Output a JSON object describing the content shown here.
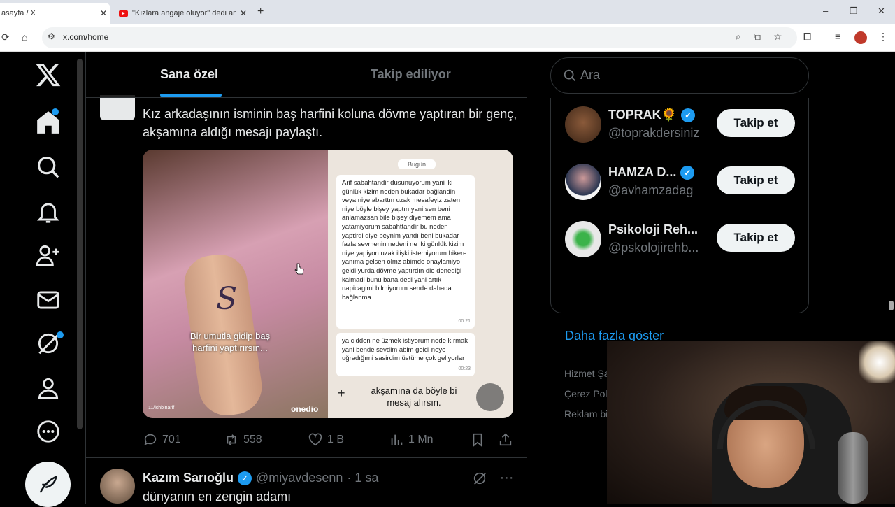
{
  "browser": {
    "active_tab_title": "asayfa / X",
    "other_tab_title": "\"Kızlara angaje oluyor\" dedi am",
    "url": "x.com/home",
    "close_glyph": "✕",
    "new_tab_glyph": "+",
    "controls": [
      "–",
      "❐",
      "✕"
    ]
  },
  "feed": {
    "tabs": [
      {
        "label": "Sana özel",
        "active": true
      },
      {
        "label": "Takip ediliyor",
        "active": false
      }
    ],
    "tweet": {
      "text": "Kız arkadaşının isminin baş harfini koluna dövme yaptıran bir genç, akşamına aldığı mesajı paylaştı.",
      "media": {
        "photo_caption": "Bir umutla gidip baş harfini yaptırırsın...",
        "tattoo_letter": "S",
        "watermark_left": "11/ichbinarif",
        "watermark_brand": "onedio",
        "chat_day": "Bugün",
        "message1": "Arif sabahtandir dusunuyorum yani iki günlük kizim neden bukadar bağlandin veya niye abarttın uzak mesafeyiz zaten niye böyle bişey yaptın yani sen beni anlamazsan bile bişey diyemem ama yatamiyorum sabahttandir bu neden yaptirdi diye beynim yandı beni bukadar fazla sevmenin nedeni ne iki günlük kizim niye yapiyon uzak ilişki istemiyorum bikere yanıma gelsen olmz abimde onaylamiyo geldi yurda dövme yaptırdın die denediği kalmadi bunu bana dedi yani artık napicagimi bilmiyorum sende dahada bağlanma",
        "message1_time": "00:21",
        "message2": "ya cidden ne üzmek istiyorum nede kırmak yani bende sevdim abim geldi neye uğradığımi sasirdim üstüme çok geliyorlar",
        "message2_time": "00:23",
        "bottom_caption": "akşamına da böyle bi mesaj alırsın.",
        "plus_glyph": "+"
      },
      "replies": "701",
      "reposts": "558",
      "likes": "1 B",
      "views": "1 Mn"
    },
    "tweet2": {
      "name": "Kazım Sarıoğlu",
      "handle": "@miyavdesenn",
      "time": "· 1 sa",
      "text": "dünyanın en zengin adamı",
      "more_glyph": "···"
    }
  },
  "right": {
    "search_placeholder": "Ara",
    "who_to_follow": [
      {
        "name": "TOPRAK🌻",
        "handle": "@toprakdersiniz",
        "button": "Takip et",
        "avatar_color": "#6b4a2e"
      },
      {
        "name": "HAMZA D...",
        "handle": "@avhamzadag",
        "button": "Takip et",
        "avatar_color": "#f4f4f4"
      },
      {
        "name": "Psikoloji Reh...",
        "handle": "@pskolojirehb...",
        "button": "Takip et",
        "avatar_color": "#e8e8e8"
      }
    ],
    "show_more": "Daha fazla göster",
    "footer": [
      "Hizmet Şa",
      "Çerez Poli",
      "Reklam bi"
    ]
  },
  "colors": {
    "accent": "#1d9bf0",
    "text": "#e7e9ea",
    "muted": "#71767b",
    "border": "#2f3336"
  }
}
